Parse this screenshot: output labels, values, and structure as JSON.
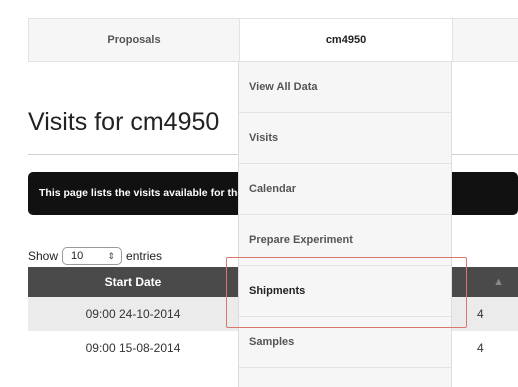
{
  "nav": {
    "tabs": [
      {
        "label": "Proposals"
      },
      {
        "label": "cm4950"
      }
    ]
  },
  "page": {
    "title": "Visits for cm4950",
    "banner": "This page lists the visits available for the selected proposal"
  },
  "table": {
    "length_prefix": "Show",
    "length_value": "10",
    "length_suffix": "entries",
    "columns": [
      "Start Date"
    ],
    "rows": [
      {
        "start": "09:00 24-10-2014",
        "trail": "4"
      },
      {
        "start": "09:00 15-08-2014",
        "trail": "4"
      }
    ]
  },
  "dropdown": {
    "items": [
      {
        "label": "View All Data"
      },
      {
        "label": "Visits"
      },
      {
        "label": "Calendar"
      },
      {
        "label": "Prepare Experiment"
      },
      {
        "label": "Shipments"
      },
      {
        "label": "Samples"
      }
    ],
    "highlighted_item": "Shipments",
    "highlight_color": "#d9786a"
  }
}
